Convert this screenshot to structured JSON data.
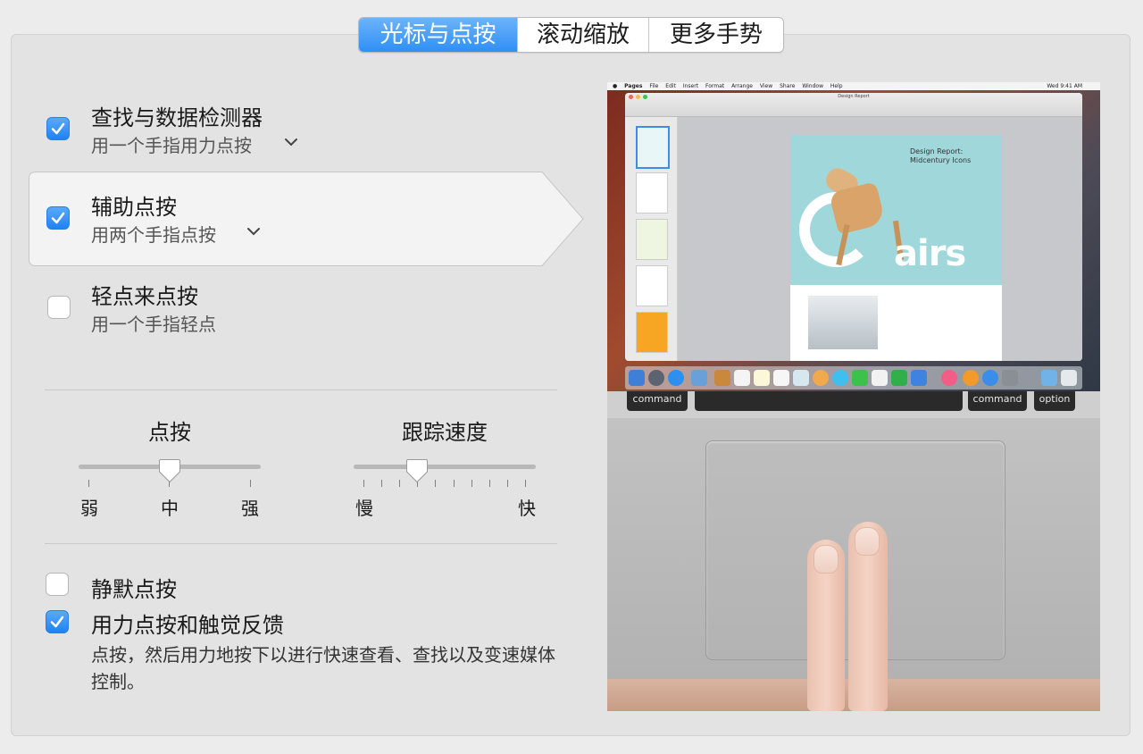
{
  "tabs": [
    {
      "label": "光标与点按",
      "active": true
    },
    {
      "label": "滚动缩放",
      "active": false
    },
    {
      "label": "更多手势",
      "active": false
    }
  ],
  "options": [
    {
      "title": "查找与数据检测器",
      "subtitle": "用一个手指用力点按",
      "checked": true,
      "has_menu": true
    },
    {
      "title": "辅助点按",
      "subtitle": "用两个手指点按",
      "checked": true,
      "has_menu": true,
      "highlighted": true
    },
    {
      "title": "轻点来点按",
      "subtitle": "用一个手指轻点",
      "checked": false,
      "has_menu": false
    }
  ],
  "click_slider": {
    "label": "点按",
    "ticks": [
      "弱",
      "中",
      "强"
    ],
    "value_label": "中"
  },
  "tracking_slider": {
    "label": "跟踪速度",
    "min_label": "慢",
    "max_label": "快",
    "value_step": 3,
    "steps": 10
  },
  "bottom_options": [
    {
      "title": "静默点按",
      "checked": false
    },
    {
      "title": "用力点按和触觉反馈",
      "checked": true,
      "description": "点按，然后用力地按下以进行快速查看、查找以及变速媒体控制。"
    }
  ],
  "preview": {
    "menubar": [
      "Pages",
      "File",
      "Edit",
      "Insert",
      "Format",
      "Arrange",
      "View",
      "Share",
      "Window",
      "Help"
    ],
    "clock": "Wed 9:41 AM",
    "window_title": "Design Report",
    "doc_heading": "Design Report: Midcentury Icons",
    "doc_big_text": "airs",
    "keys": [
      "command",
      "command",
      "option"
    ]
  },
  "colors": {
    "accent": "#2f8ff5",
    "panel": "#e3e3e3",
    "background": "#ececec"
  }
}
